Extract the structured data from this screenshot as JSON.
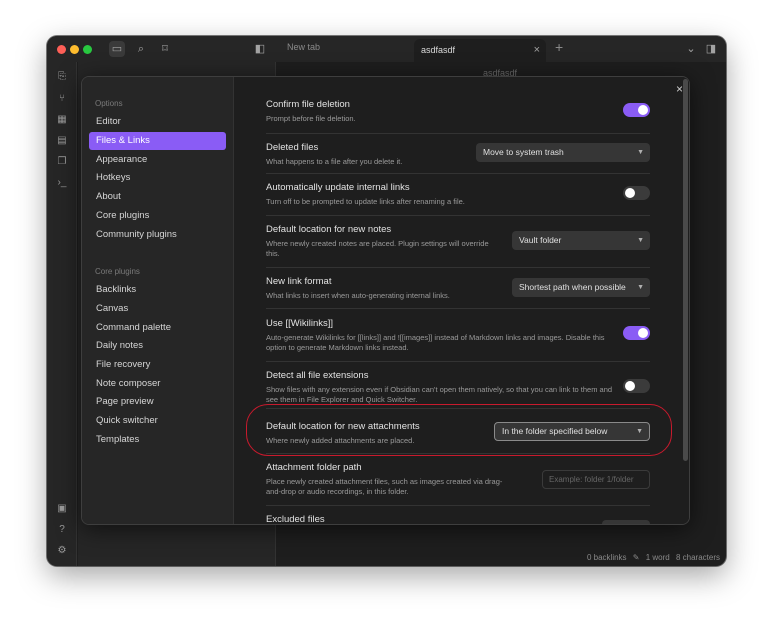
{
  "window": {
    "tabs": [
      {
        "label": "New tab",
        "active": false
      },
      {
        "label": "asdfasdf",
        "active": true
      }
    ],
    "editor_title": "asdfasdf",
    "status_bar": {
      "backlinks": "0 backlinks",
      "words": "1 word",
      "characters": "8 characters"
    }
  },
  "modal": {
    "close_label": "×",
    "sidebar": {
      "options_header": "Options",
      "options_items": [
        "Editor",
        "Files & Links",
        "Appearance",
        "Hotkeys",
        "About",
        "Core plugins",
        "Community plugins"
      ],
      "active_item": "Files & Links",
      "core_plugins_header": "Core plugins",
      "core_plugins_items": [
        "Backlinks",
        "Canvas",
        "Command palette",
        "Daily notes",
        "File recovery",
        "Note composer",
        "Page preview",
        "Quick switcher",
        "Templates"
      ]
    },
    "settings": [
      {
        "name": "Confirm file deletion",
        "desc": "Prompt before file deletion.",
        "control": "toggle",
        "value": true
      },
      {
        "name": "Deleted files",
        "desc": "What happens to a file after you delete it.",
        "control": "dropdown",
        "value": "Move to system trash"
      },
      {
        "name": "Automatically update internal links",
        "desc": "Turn off to be prompted to update links after renaming a file.",
        "control": "toggle",
        "value": false
      },
      {
        "name": "Default location for new notes",
        "desc": "Where newly created notes are placed. Plugin settings will override this.",
        "control": "dropdown",
        "value": "Vault folder"
      },
      {
        "name": "New link format",
        "desc": "What links to insert when auto-generating internal links.",
        "control": "dropdown",
        "value": "Shortest path when possible"
      },
      {
        "name": "Use [[Wikilinks]]",
        "desc": "Auto-generate Wikilinks for [[links]] and ![[images]] instead of Markdown links and images. Disable this option to generate Markdown links instead.",
        "control": "toggle",
        "value": true
      },
      {
        "name": "Detect all file extensions",
        "desc": "Show files with any extension even if Obsidian can't open them natively, so that you can link to them and see them in File Explorer and Quick Switcher.",
        "control": "toggle",
        "value": false
      },
      {
        "name": "Default location for new attachments",
        "desc": "Where newly added attachments are placed.",
        "control": "dropdown",
        "value": "In the folder specified below"
      },
      {
        "name": "Attachment folder path",
        "desc": "Place newly created attachment files, such as images created via drag-and-drop or audio recordings, in this folder.",
        "control": "text",
        "placeholder": "Example: folder 1/folder"
      },
      {
        "name": "Excluded files",
        "desc": "",
        "control": "button"
      }
    ]
  },
  "colors": {
    "accent": "#8a5cf5",
    "annotation": "#c81a2d",
    "background": "#1e1e1e"
  }
}
